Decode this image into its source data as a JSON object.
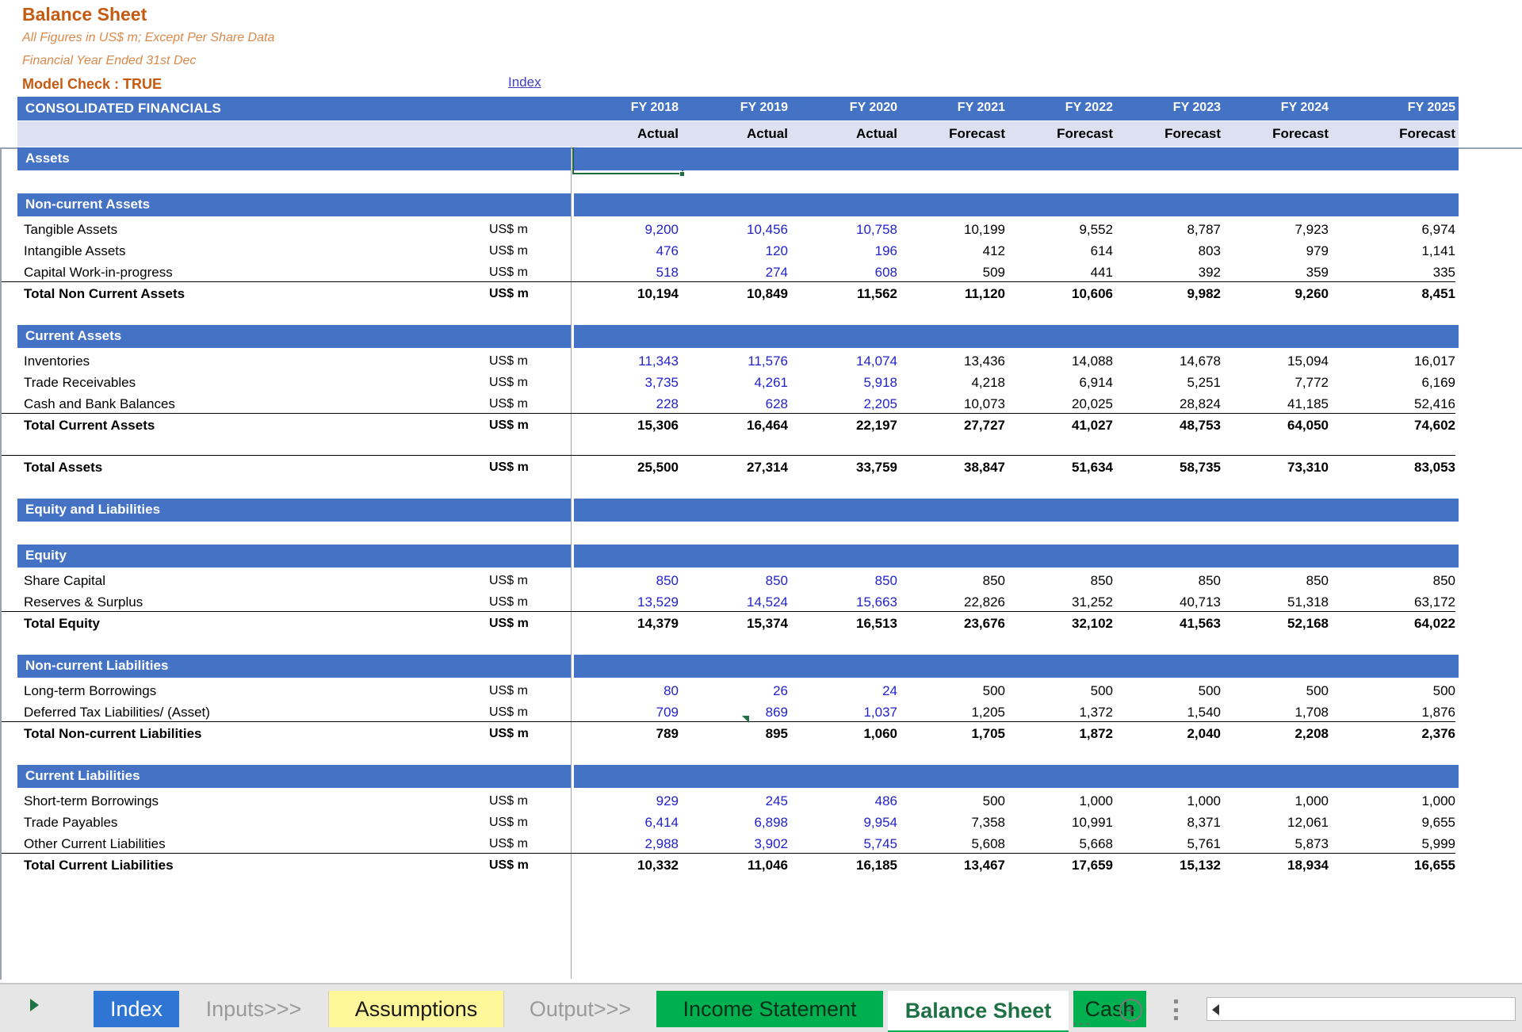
{
  "header": {
    "title": "Balance Sheet",
    "subtitle_1": "All Figures in US$ m; Except Per Share Data",
    "subtitle_2": "Financial Year Ended 31st Dec",
    "model_check": "Model Check : TRUE",
    "index_link": "Index",
    "band_title": "CONSOLIDATED FINANCIALS",
    "years": [
      "FY 2018",
      "FY 2019",
      "FY 2020",
      "FY 2021",
      "FY 2022",
      "FY 2023",
      "FY 2024",
      "FY 2025"
    ],
    "kinds": [
      "Actual",
      "Actual",
      "Actual",
      "Forecast",
      "Forecast",
      "Forecast",
      "Forecast",
      "Forecast"
    ],
    "accent_orange": "#C55A11",
    "accent_blue": "#4472C4",
    "hist_text_color": "#2222CC"
  },
  "unit_label": "US$ m",
  "sections": [
    {
      "kind": "banner",
      "label": "Assets"
    },
    {
      "kind": "spacer"
    },
    {
      "kind": "banner",
      "label": "Non-current Assets"
    },
    {
      "kind": "row",
      "label": "Tangible Assets",
      "unit": "US$ m",
      "values": [
        "9,200",
        "10,456",
        "10,758",
        "10,199",
        "9,552",
        "8,787",
        "7,923",
        "6,974"
      ]
    },
    {
      "kind": "row",
      "label": "Intangible Assets",
      "unit": "US$ m",
      "values": [
        "476",
        "120",
        "196",
        "412",
        "614",
        "803",
        "979",
        "1,141"
      ]
    },
    {
      "kind": "row",
      "label": "Capital Work-in-progress",
      "unit": "US$ m",
      "values": [
        "518",
        "274",
        "608",
        "509",
        "441",
        "392",
        "359",
        "335"
      ]
    },
    {
      "kind": "total",
      "label": "Total Non Current Assets",
      "unit": "US$ m",
      "values": [
        "10,194",
        "10,849",
        "11,562",
        "11,120",
        "10,606",
        "9,982",
        "9,260",
        "8,451"
      ]
    },
    {
      "kind": "spacer"
    },
    {
      "kind": "banner",
      "label": "Current Assets"
    },
    {
      "kind": "row",
      "label": "Inventories",
      "unit": "US$ m",
      "values": [
        "11,343",
        "11,576",
        "14,074",
        "13,436",
        "14,088",
        "14,678",
        "15,094",
        "16,017"
      ]
    },
    {
      "kind": "row",
      "label": "Trade Receivables",
      "unit": "US$ m",
      "values": [
        "3,735",
        "4,261",
        "5,918",
        "4,218",
        "6,914",
        "5,251",
        "7,772",
        "6,169"
      ]
    },
    {
      "kind": "row",
      "label": "Cash and Bank Balances",
      "unit": "US$ m",
      "values": [
        "228",
        "628",
        "2,205",
        "10,073",
        "20,025",
        "28,824",
        "41,185",
        "52,416"
      ]
    },
    {
      "kind": "total",
      "label": "Total Current Assets",
      "unit": "US$ m",
      "values": [
        "15,306",
        "16,464",
        "22,197",
        "27,727",
        "41,027",
        "48,753",
        "64,050",
        "74,602"
      ]
    },
    {
      "kind": "spacer"
    },
    {
      "kind": "total",
      "label": "Total Assets",
      "unit": "US$ m",
      "values": [
        "25,500",
        "27,314",
        "33,759",
        "38,847",
        "51,634",
        "58,735",
        "73,310",
        "83,053"
      ]
    },
    {
      "kind": "spacer"
    },
    {
      "kind": "banner",
      "label": "Equity and Liabilities"
    },
    {
      "kind": "spacer"
    },
    {
      "kind": "banner",
      "label": "Equity"
    },
    {
      "kind": "row",
      "label": "Share Capital",
      "unit": "US$ m",
      "values": [
        "850",
        "850",
        "850",
        "850",
        "850",
        "850",
        "850",
        "850"
      ]
    },
    {
      "kind": "row",
      "label": "Reserves & Surplus",
      "unit": "US$ m",
      "values": [
        "13,529",
        "14,524",
        "15,663",
        "22,826",
        "31,252",
        "40,713",
        "51,318",
        "63,172"
      ]
    },
    {
      "kind": "total",
      "label": "Total Equity",
      "unit": "US$ m",
      "values": [
        "14,379",
        "15,374",
        "16,513",
        "23,676",
        "32,102",
        "41,563",
        "52,168",
        "64,022"
      ]
    },
    {
      "kind": "spacer"
    },
    {
      "kind": "banner",
      "label": "Non-current Liabilities"
    },
    {
      "kind": "row",
      "label": "Long-term Borrowings",
      "unit": "US$ m",
      "values": [
        "80",
        "26",
        "24",
        "500",
        "500",
        "500",
        "500",
        "500"
      ]
    },
    {
      "kind": "row",
      "label": "Deferred Tax Liabilities/ (Asset)",
      "unit": "US$ m",
      "values": [
        "709",
        "869",
        "1,037",
        "1,205",
        "1,372",
        "1,540",
        "1,708",
        "1,876"
      ]
    },
    {
      "kind": "total",
      "label": "Total Non-current Liabilities",
      "unit": "US$ m",
      "values": [
        "789",
        "895",
        "1,060",
        "1,705",
        "1,872",
        "2,040",
        "2,208",
        "2,376"
      ]
    },
    {
      "kind": "spacer"
    },
    {
      "kind": "banner",
      "label": "Current Liabilities"
    },
    {
      "kind": "row",
      "label": "Short-term Borrowings",
      "unit": "US$ m",
      "values": [
        "929",
        "245",
        "486",
        "500",
        "1,000",
        "1,000",
        "1,000",
        "1,000"
      ]
    },
    {
      "kind": "row",
      "label": "Trade Payables",
      "unit": "US$ m",
      "values": [
        "6,414",
        "6,898",
        "9,954",
        "7,358",
        "10,991",
        "8,371",
        "12,061",
        "9,655"
      ]
    },
    {
      "kind": "row",
      "label": "Other Current Liabilities",
      "unit": "US$ m",
      "values": [
        "2,988",
        "3,902",
        "5,745",
        "5,608",
        "5,668",
        "5,761",
        "5,873",
        "5,999"
      ]
    },
    {
      "kind": "total",
      "label": "Total Current Liabilities",
      "unit": "US$ m",
      "values": [
        "10,332",
        "11,046",
        "16,185",
        "13,467",
        "17,659",
        "15,132",
        "18,934",
        "16,655"
      ]
    }
  ],
  "tabbar": {
    "nav_arrow": "nav-right-arrow",
    "tabs": [
      {
        "label": "Index",
        "style": "index"
      },
      {
        "label": "Inputs>>>",
        "style": "plain"
      },
      {
        "label": "Assumptions",
        "style": "assump"
      },
      {
        "label": "Output>>>",
        "style": "plain"
      },
      {
        "label": "Income Statement",
        "style": "green"
      },
      {
        "label": "Balance Sheet",
        "style": "active"
      },
      {
        "label": "Cash",
        "style": "green"
      }
    ],
    "overflow": "...",
    "add_sheet": "+",
    "scroll_left": "scroll-left-arrow"
  }
}
